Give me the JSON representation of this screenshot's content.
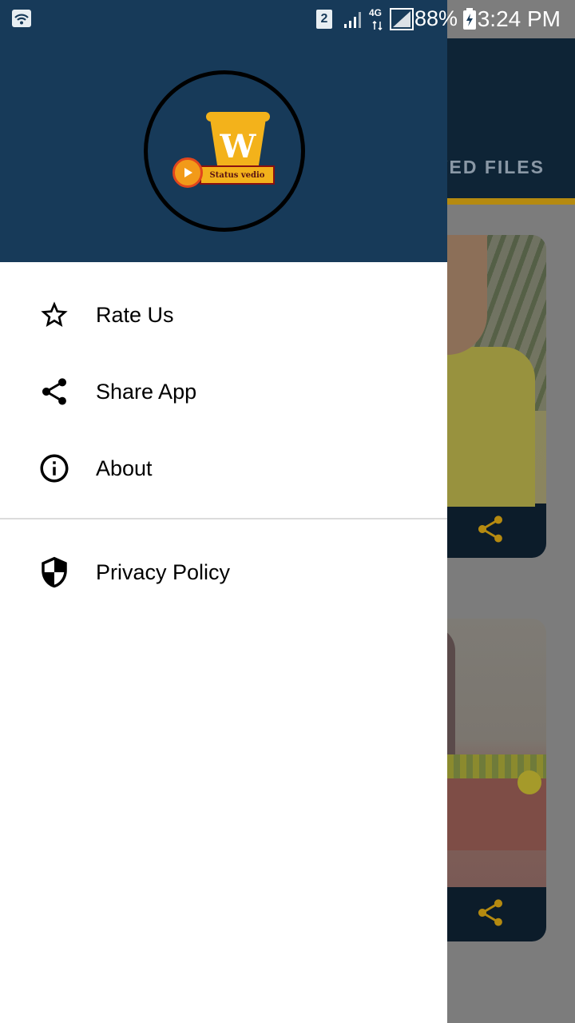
{
  "status_bar": {
    "sim_slot": "2",
    "network_type": "4G",
    "battery": "88%",
    "time": "3:24 PM"
  },
  "background_app": {
    "tab_label": "VED FILES",
    "cards": [
      {
        "icon": "share-icon"
      },
      {
        "icon": "share-icon"
      }
    ]
  },
  "drawer": {
    "logo": {
      "letter": "W",
      "banner_text": "Status vedio"
    },
    "menu_primary": [
      {
        "label": "Rate Us",
        "icon": "star-outline-icon"
      },
      {
        "label": "Share App",
        "icon": "share-icon"
      },
      {
        "label": "About",
        "icon": "info-icon"
      }
    ],
    "menu_secondary": [
      {
        "label": "Privacy Policy",
        "icon": "shield-icon"
      }
    ]
  },
  "colors": {
    "drawer_header": "#173a59",
    "accent": "#f3b21b",
    "share_icon": "#b58a10"
  }
}
